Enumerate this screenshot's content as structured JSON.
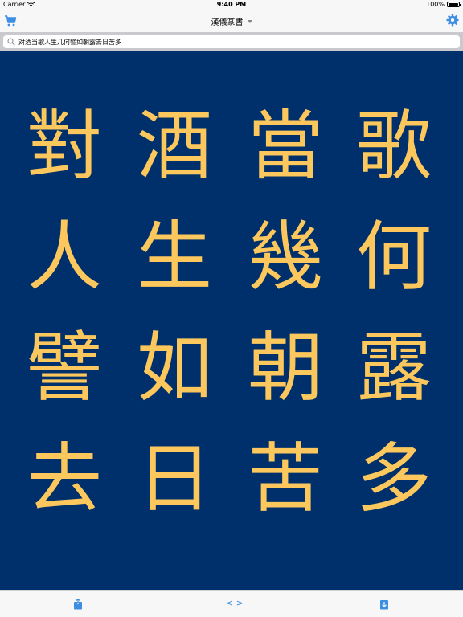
{
  "status_bar": {
    "carrier": "Carrier",
    "time": "9:40 PM",
    "battery_percent": "100%"
  },
  "nav_bar": {
    "title": "漢儀篆書",
    "left_icon": "cart-icon",
    "right_icon": "gear-icon"
  },
  "search": {
    "value": "对酒当歌人生几何譬如朝露去日苦多",
    "icon": "search-icon"
  },
  "canvas": {
    "background": "#00306b",
    "glyph_color": "#fcc75c",
    "columns": [
      {
        "glyphs": [
          "歌",
          "何",
          "露",
          "多"
        ]
      },
      {
        "glyphs": [
          "當",
          "幾",
          "朝",
          "苦"
        ]
      },
      {
        "glyphs": [
          "酒",
          "生",
          "如",
          "日"
        ]
      },
      {
        "glyphs": [
          "對",
          "人",
          "譬",
          "去"
        ]
      }
    ]
  },
  "toolbar": {
    "share_icon": "share-icon",
    "code_label": "< >",
    "save_icon": "download-icon",
    "accent": "#3c8ee3"
  }
}
